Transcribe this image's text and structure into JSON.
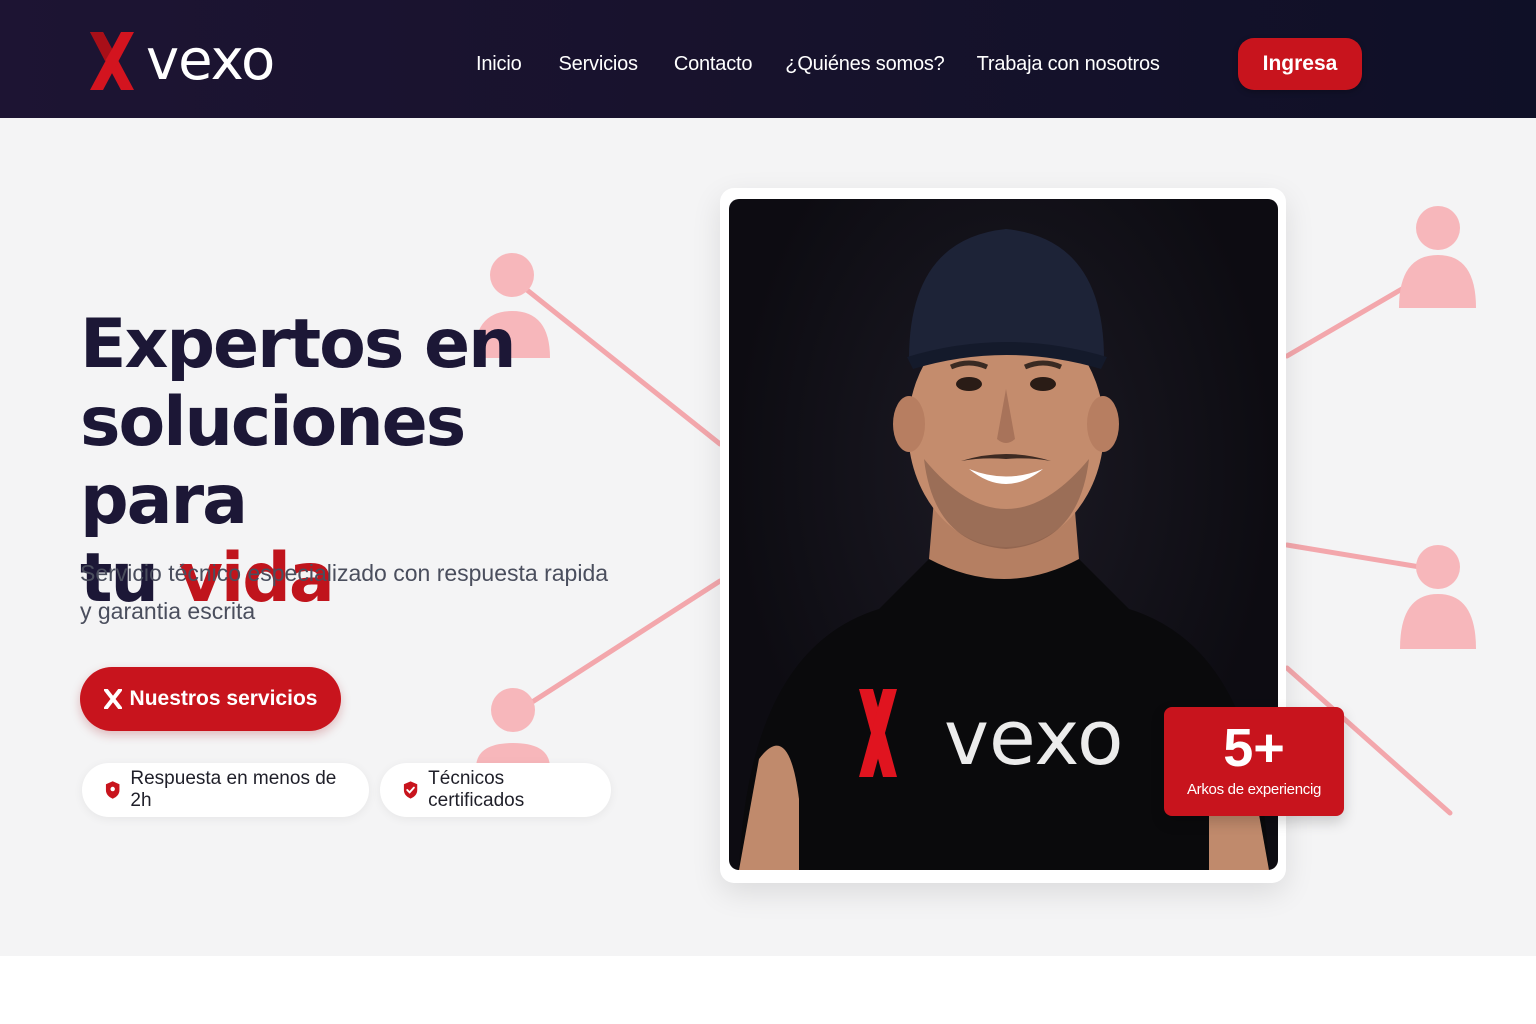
{
  "brand": {
    "name": "vexo",
    "accent_color": "#c8141d",
    "dark_color": "#1c1736"
  },
  "nav": {
    "links": [
      "Inicio",
      "Servicios",
      "Contacto",
      "¿Quiénes somos?",
      "Trabaja con nosotros"
    ],
    "cta_label": "Ingresa"
  },
  "hero": {
    "headline_line1": "Expertos en",
    "headline_line2": "soluciones para",
    "headline_line3_plain": "tu ",
    "headline_line3_accent": "vida",
    "subtitle": "Servicio técnico especializado con respuesta rapida y garantia escrita",
    "primary_button_label": "Nuestros servicios",
    "badges": [
      {
        "icon": "shield-icon",
        "label": "Respuesta en menos de 2h"
      },
      {
        "icon": "check-badge-icon",
        "label": "Técnicos certificados"
      }
    ],
    "photo_shirt_logo": "vexo"
  },
  "experience": {
    "value": "5+",
    "label": "Arkos de experiencig"
  },
  "decorations": {
    "person_icon_color": "#f7b7bb",
    "line_color": "#f39aa0"
  }
}
